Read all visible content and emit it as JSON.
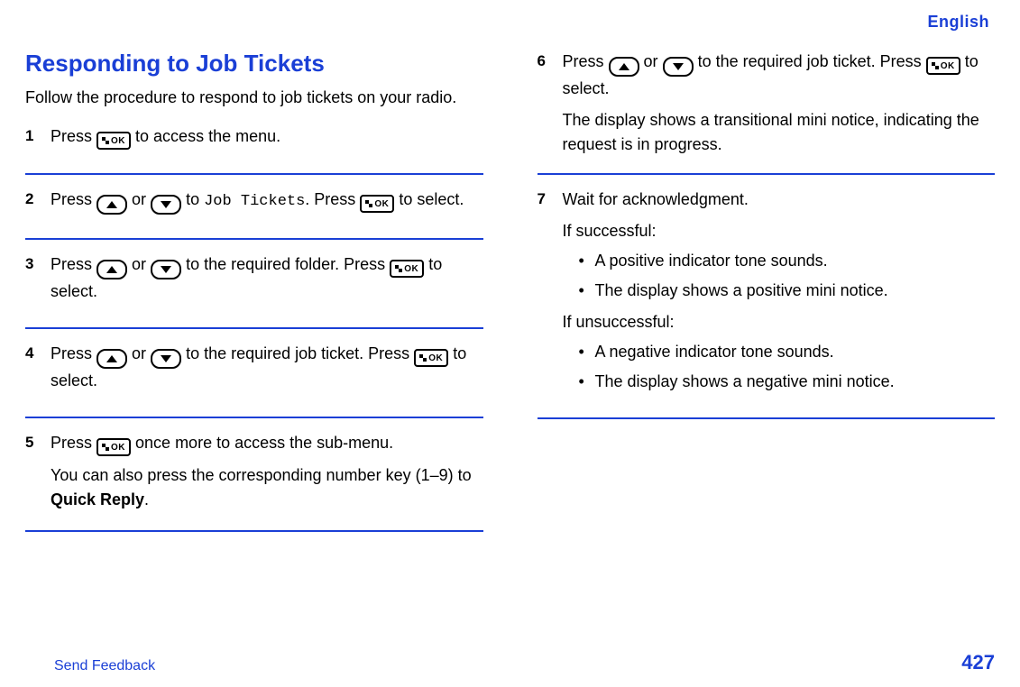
{
  "header": {
    "language": "English"
  },
  "title": "Responding to Job Tickets",
  "intro": "Follow the procedure to respond to job tickets on your radio.",
  "col_left": {
    "steps": [
      {
        "num": "1",
        "line1_a": "Press ",
        "line1_b": " to access the menu."
      },
      {
        "num": "2",
        "line1_a": "Press ",
        "line1_or": " or ",
        "line1_b": " to ",
        "mono": "Job Tickets",
        "line1_c": ". Press ",
        "line1_d": " to select."
      },
      {
        "num": "3",
        "line1_a": "Press ",
        "line1_or": " or ",
        "line1_b": " to the required folder. Press ",
        "line1_c": " to select."
      },
      {
        "num": "4",
        "line1_a": "Press ",
        "line1_or": " or ",
        "line1_b": " to the required job ticket. Press ",
        "line1_c": " to select."
      },
      {
        "num": "5",
        "line1_a": "Press ",
        "line1_b": " once more to access the sub-menu.",
        "note_a": "You can also press the corresponding number key (1–9) to ",
        "note_bold": "Quick Reply",
        "note_b": "."
      }
    ]
  },
  "col_right": {
    "steps": [
      {
        "num": "6",
        "line1_a": "Press ",
        "line1_or": " or ",
        "line1_b": " to the required job ticket. Press ",
        "line1_c": " to select.",
        "note": "The display shows a transitional mini notice, indicating the request is in progress."
      },
      {
        "num": "7",
        "line1": "Wait for acknowledgment.",
        "if_success": "If successful:",
        "success_bullets": [
          "A positive indicator tone sounds.",
          "The display shows a positive mini notice."
        ],
        "if_unsuccess": "If unsuccessful:",
        "unsuccess_bullets": [
          "A negative indicator tone sounds.",
          "The display shows a negative mini notice."
        ]
      }
    ]
  },
  "footer": {
    "feedback": "Send Feedback",
    "page": "427"
  },
  "icons": {
    "ok_label": "OK"
  }
}
